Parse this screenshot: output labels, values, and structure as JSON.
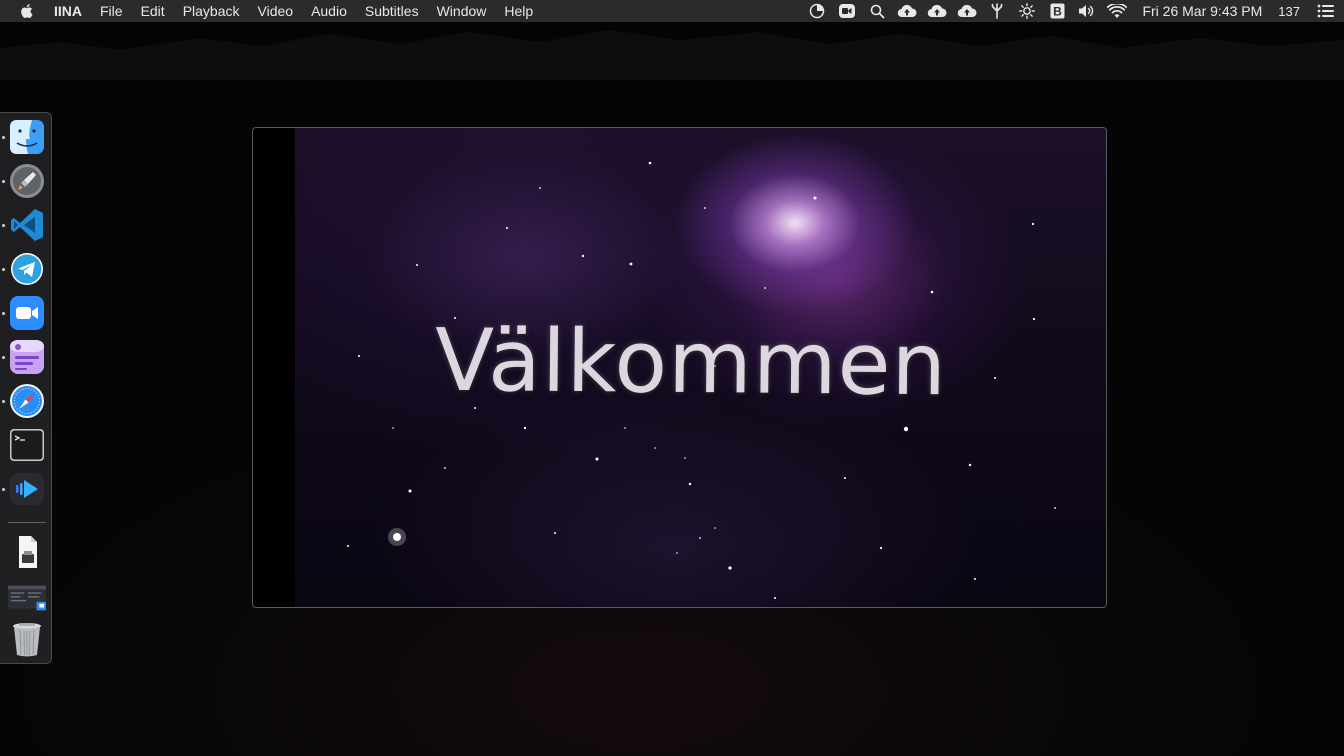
{
  "menubar": {
    "app_name": "IINA",
    "menus": [
      "File",
      "Edit",
      "Playback",
      "Video",
      "Audio",
      "Subtitles",
      "Window",
      "Help"
    ],
    "status_icons": [
      "screen-time-icon",
      "zoom-icon",
      "spotlight-search-icon",
      "cloud-upload-icon",
      "cloud-upload-icon",
      "cloud-upload-icon",
      "bluetooth-fork-icon",
      "brightness-icon",
      "b-badge-icon",
      "volume-icon",
      "wifi-icon"
    ],
    "clock": "Fri 26 Mar  9:43 PM",
    "count": "137",
    "control_center_icon": "list-icon"
  },
  "dock": {
    "apps": [
      {
        "name": "finder",
        "running": true
      },
      {
        "name": "launchpad",
        "running": true
      },
      {
        "name": "visual-studio-code",
        "running": true
      },
      {
        "name": "telegram",
        "running": true
      },
      {
        "name": "zoom",
        "running": true
      },
      {
        "name": "notes-app",
        "running": true
      },
      {
        "name": "safari",
        "running": true
      },
      {
        "name": "terminal",
        "running": false
      },
      {
        "name": "iina",
        "running": true
      }
    ],
    "others": [
      "documents-stack",
      "screenshot-stack",
      "trash"
    ]
  },
  "player": {
    "video_title_text": "Välkommen"
  },
  "colors": {
    "menubar_bg": "#2b2b2d",
    "dock_bg": "#28282a",
    "player_border": "#5b5b5e"
  }
}
